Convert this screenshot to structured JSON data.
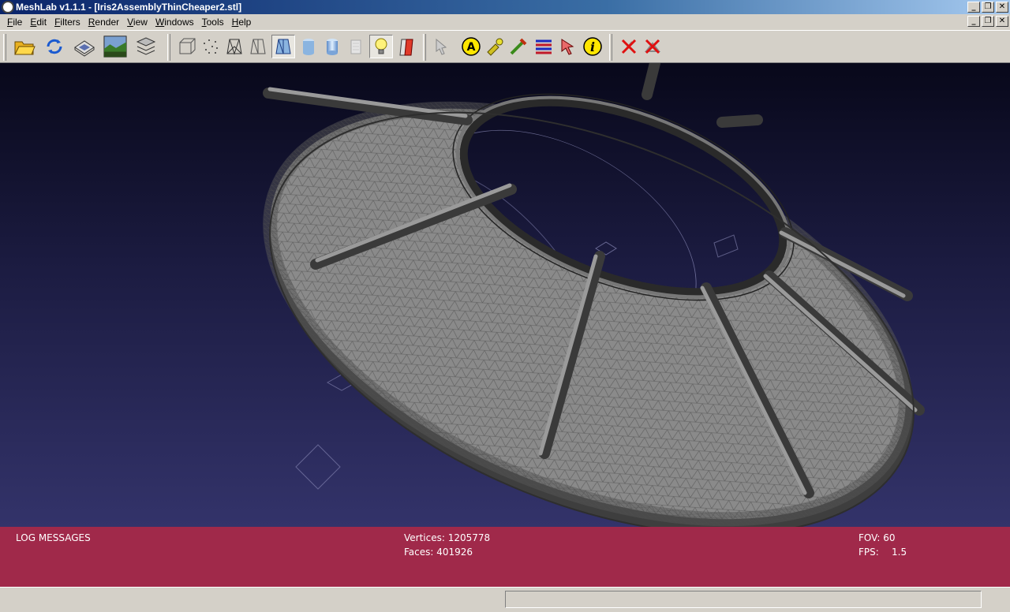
{
  "window": {
    "title": "MeshLab v1.1.1 - [Iris2AssemblyThinCheaper2.stl]",
    "buttons": [
      "minimize",
      "restore",
      "close"
    ]
  },
  "menubar": {
    "items": [
      {
        "mnemonic": "F",
        "rest": "ile"
      },
      {
        "mnemonic": "E",
        "rest": "dit"
      },
      {
        "mnemonic": "F",
        "rest": "ilters"
      },
      {
        "mnemonic": "R",
        "rest": "ender"
      },
      {
        "mnemonic": "V",
        "rest": "iew"
      },
      {
        "mnemonic": "W",
        "rest": "indows"
      },
      {
        "mnemonic": "T",
        "rest": "ools"
      },
      {
        "mnemonic": "H",
        "rest": "elp"
      }
    ]
  },
  "toolbar": {
    "icons": [
      "open-folder-icon",
      "reload-icon",
      "save-icon",
      "snapshot-icon",
      "layers-icon",
      "bbox-icon",
      "points-icon",
      "wireframe-icon",
      "hidden-lines-icon",
      "flat-lines-icon",
      "flat-icon",
      "smooth-icon",
      "texture-icon",
      "light-icon",
      "double-light-icon",
      "select-faces-icon",
      "annotation-icon",
      "paint-icon",
      "measure-icon",
      "align-icon",
      "pick-icon",
      "info-icon",
      "delete-faces-icon",
      "delete-vertices-icon"
    ],
    "info_glyph": "i",
    "annotation_glyph": "A",
    "pressed": [
      "flat-lines-icon",
      "light-icon"
    ]
  },
  "log": {
    "title": "LOG MESSAGES",
    "vertices_label": "Vertices: 1205778",
    "faces_label": "Faces: 401926",
    "fov_label": "FOV: 60",
    "fps_label": "FPS:",
    "fps_value": "1.5"
  },
  "colors": {
    "log_bg": "#a0294a",
    "viewport_top": "#08081a",
    "viewport_bottom": "#33336a",
    "mesh": "#8a8a8a"
  }
}
